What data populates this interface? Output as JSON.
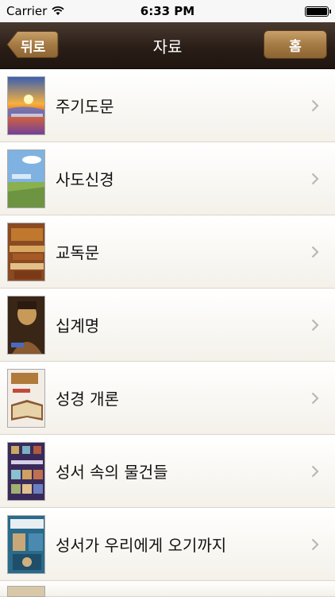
{
  "status_bar": {
    "carrier": "Carrier",
    "time": "6:33 PM"
  },
  "navbar": {
    "back_label": "뒤로",
    "title": "자료",
    "home_label": "홈"
  },
  "items": [
    {
      "label": "주기도문"
    },
    {
      "label": "사도신경"
    },
    {
      "label": "교독문"
    },
    {
      "label": "십계명"
    },
    {
      "label": "성경 개론"
    },
    {
      "label": "성서 속의 물건들"
    },
    {
      "label": "성서가 우리에게 오기까지"
    }
  ],
  "colors": {
    "navbar": "#2a1e17",
    "home_button": "#a57a44",
    "row_bg": "#f4f1ea"
  }
}
